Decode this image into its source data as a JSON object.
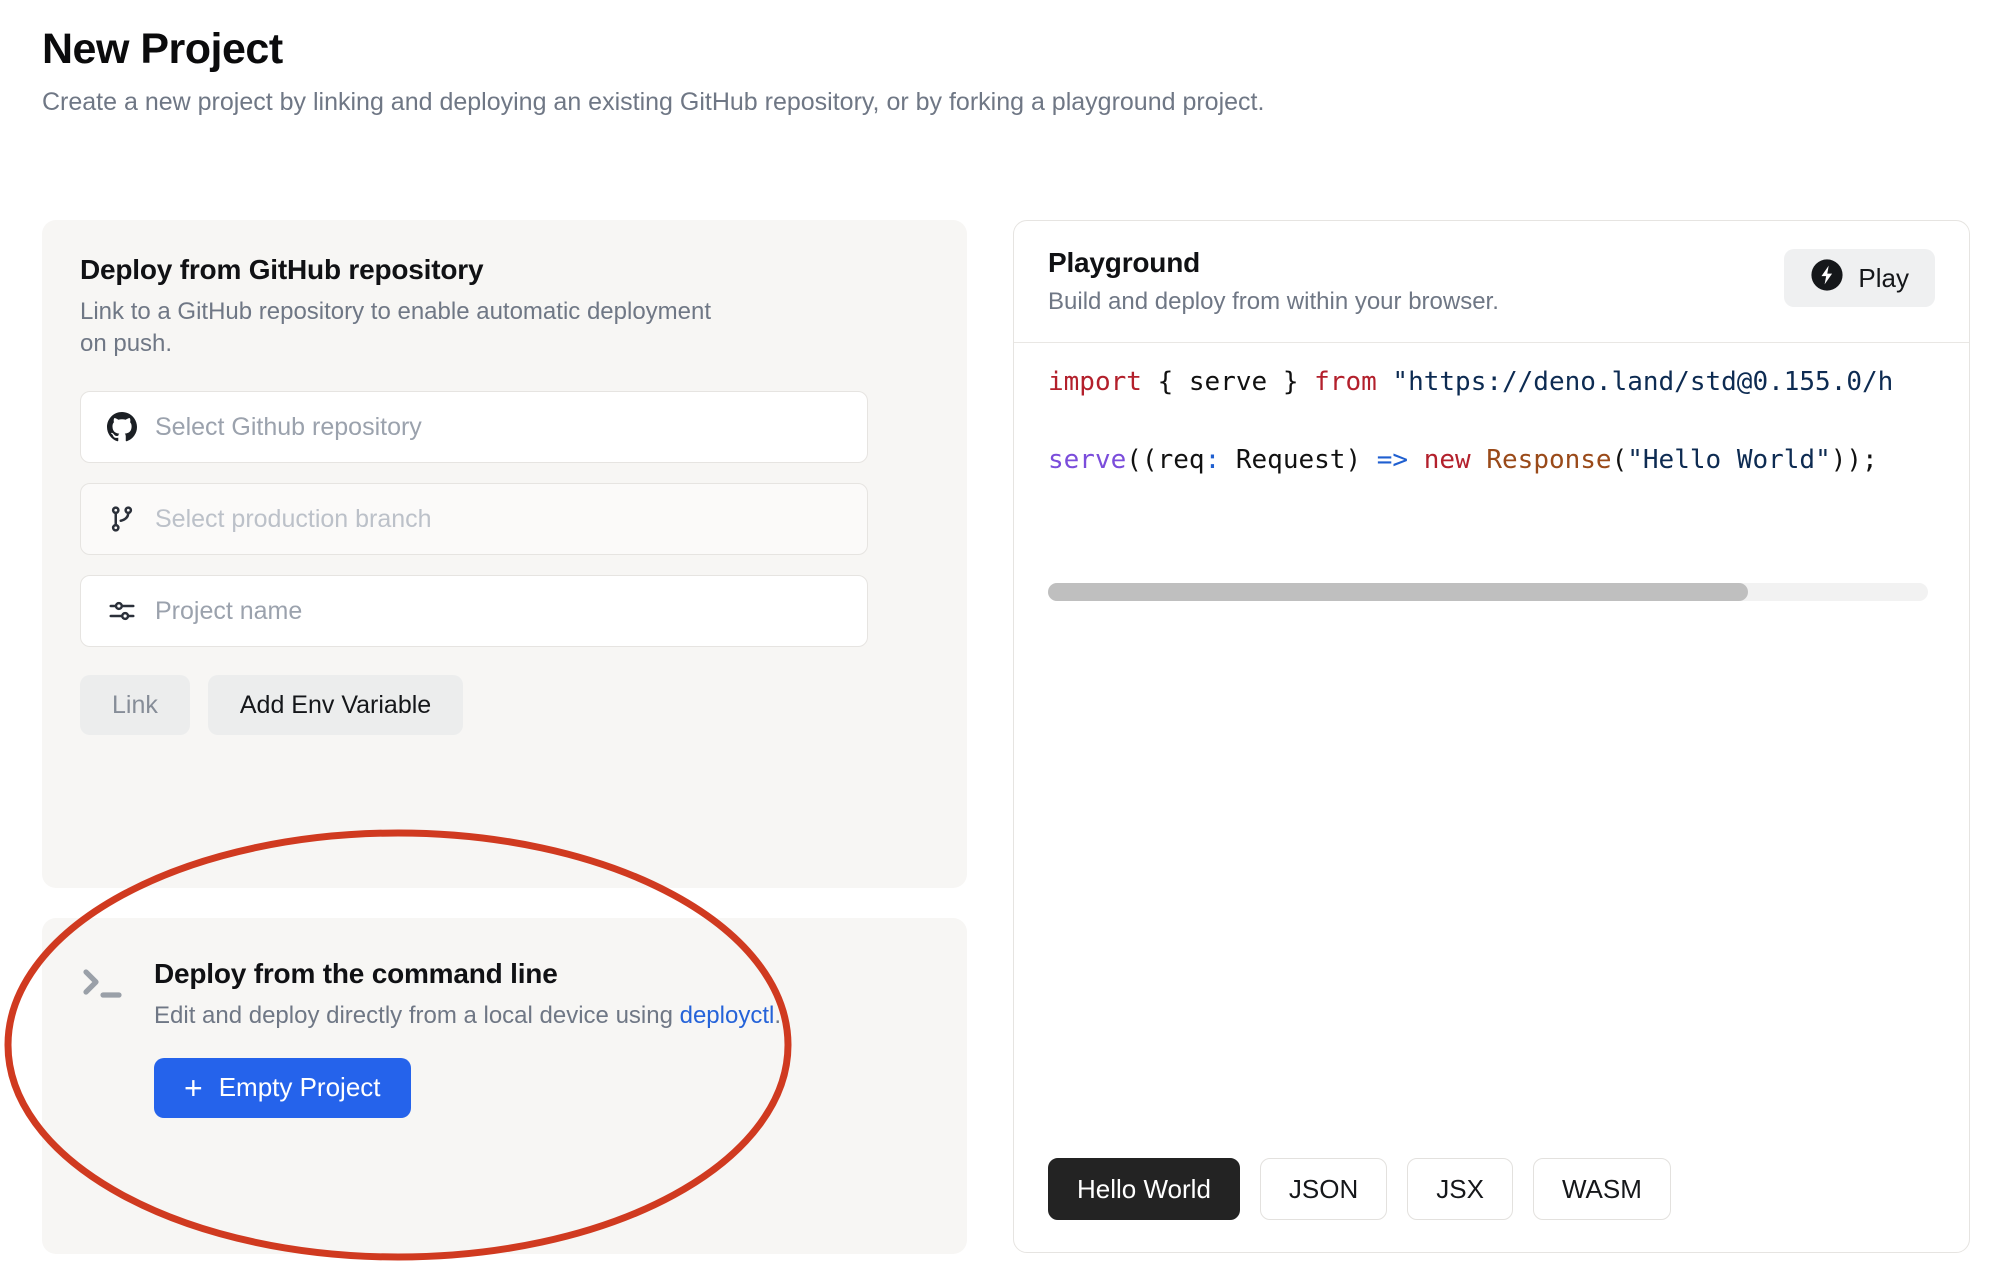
{
  "page": {
    "title": "New Project",
    "subtitle": "Create a new project by linking and deploying an existing GitHub repository, or by forking a playground project."
  },
  "github_card": {
    "heading": "Deploy from GitHub repository",
    "description": "Link to a GitHub repository to enable automatic deployment on push.",
    "fields": [
      {
        "name": "repository",
        "icon": "github-icon",
        "placeholder": "Select Github repository",
        "value": "",
        "disabled": false
      },
      {
        "name": "branch",
        "icon": "git-branch-icon",
        "placeholder": "Select production branch",
        "value": "",
        "disabled": true
      },
      {
        "name": "project_name",
        "icon": "sliders-icon",
        "placeholder": "Project name",
        "value": "",
        "disabled": false
      }
    ],
    "buttons": {
      "link": {
        "label": "Link",
        "disabled": true
      },
      "add_env": {
        "label": "Add Env Variable",
        "disabled": false
      }
    }
  },
  "cli_card": {
    "icon": "terminal-prompt-icon",
    "heading": "Deploy from the command line",
    "description_prefix": "Edit and deploy directly from a local device using ",
    "link_label": "deployctl",
    "description_suffix": ".",
    "button": {
      "label": "Empty Project",
      "icon": "plus-icon"
    }
  },
  "playground": {
    "heading": "Playground",
    "description": "Build and deploy from within your browser.",
    "play_button": {
      "label": "Play",
      "icon": "lightning-bolt-icon"
    },
    "editor": {
      "line1": {
        "kw_import": "import",
        "braces_open": " { ",
        "ident_serve": "serve",
        "braces_close": " } ",
        "kw_from": "from",
        "space": " ",
        "string": "\"https://deno.land/std@0.155.0/h"
      },
      "line2": {
        "fn_serve": "serve",
        "punc_open": "((",
        "param": "req",
        "colon": ":",
        "type": " Request",
        "punc_close": ") ",
        "arrow": "=>",
        "kw_new": " new ",
        "cls": "Response",
        "call_open": "(",
        "string": "\"Hello World\"",
        "call_close": "));"
      },
      "scrollbar": {
        "visible": true
      }
    },
    "templates": [
      {
        "label": "Hello World",
        "active": true
      },
      {
        "label": "JSON",
        "active": false
      },
      {
        "label": "JSX",
        "active": false
      },
      {
        "label": "WASM",
        "active": false
      }
    ]
  },
  "annotation": {
    "shape": "ellipse",
    "color": "#d03a20",
    "target": "cli_card"
  },
  "colors": {
    "accent_blue": "#2563eb",
    "link_blue": "#2563d9",
    "annotation_red": "#d03a20",
    "card_grey": "#f7f6f4",
    "text_primary": "#101114",
    "text_muted": "#6f7785",
    "active_tab": "#232323"
  }
}
